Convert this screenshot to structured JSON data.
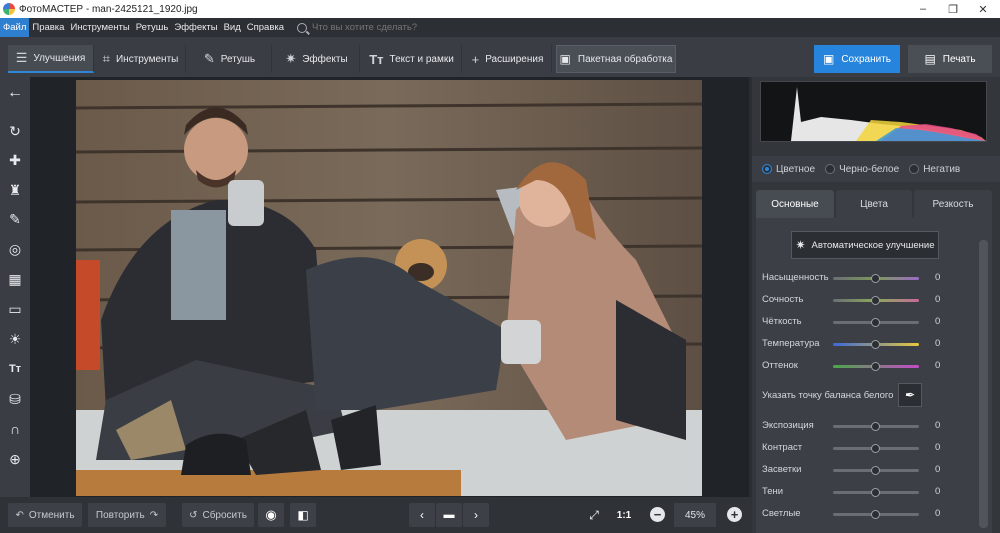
{
  "window": {
    "title": "ФотоМАСТЕР - man-2425121_1920.jpg",
    "controls": [
      "–",
      "❐",
      "✕"
    ]
  },
  "menu": {
    "items": [
      "Файл",
      "Правка",
      "Инструменты",
      "Ретушь",
      "Эффекты",
      "Вид",
      "Справка"
    ],
    "search_placeholder": "Что вы хотите сделать?"
  },
  "toolbar": {
    "tabs": [
      {
        "label": "Улучшения",
        "icon": "sliders-icon"
      },
      {
        "label": "Инструменты",
        "icon": "crop-icon"
      },
      {
        "label": "Ретушь",
        "icon": "brush-icon"
      },
      {
        "label": "Эффекты",
        "icon": "magic-wand-icon"
      },
      {
        "label": "Текст и рамки",
        "icon": "text-icon"
      },
      {
        "label": "Расширения",
        "icon": "plus-icon"
      }
    ],
    "batch_label": "Пакетная обработка",
    "save_label": "Сохранить",
    "print_label": "Печать"
  },
  "bottombar": {
    "undo_label": "Отменить",
    "redo_label": "Повторить",
    "reset_label": "Сбросить",
    "one_to_one": "1:1",
    "zoom": "45%"
  },
  "panel": {
    "modes": [
      "Цветное",
      "Черно-белое",
      "Негатив"
    ],
    "tabs": [
      "Основные",
      "Цвета",
      "Резкость"
    ],
    "auto_label": "Автоматическое улучшение",
    "white_balance_label": "Указать точку баланса белого",
    "sliders_top": [
      {
        "label": "Насыщенность",
        "value": "0"
      },
      {
        "label": "Сочность",
        "value": "0"
      },
      {
        "label": "Чёткость",
        "value": "0"
      },
      {
        "label": "Температура",
        "value": "0"
      },
      {
        "label": "Оттенок",
        "value": "0"
      }
    ],
    "sliders_bottom": [
      {
        "label": "Экспозиция",
        "value": "0"
      },
      {
        "label": "Контраст",
        "value": "0"
      },
      {
        "label": "Засветки",
        "value": "0"
      },
      {
        "label": "Тени",
        "value": "0"
      },
      {
        "label": "Светлые",
        "value": "0"
      }
    ]
  },
  "colors": {
    "accent": "#2784dc",
    "background": "#2b2e33"
  }
}
